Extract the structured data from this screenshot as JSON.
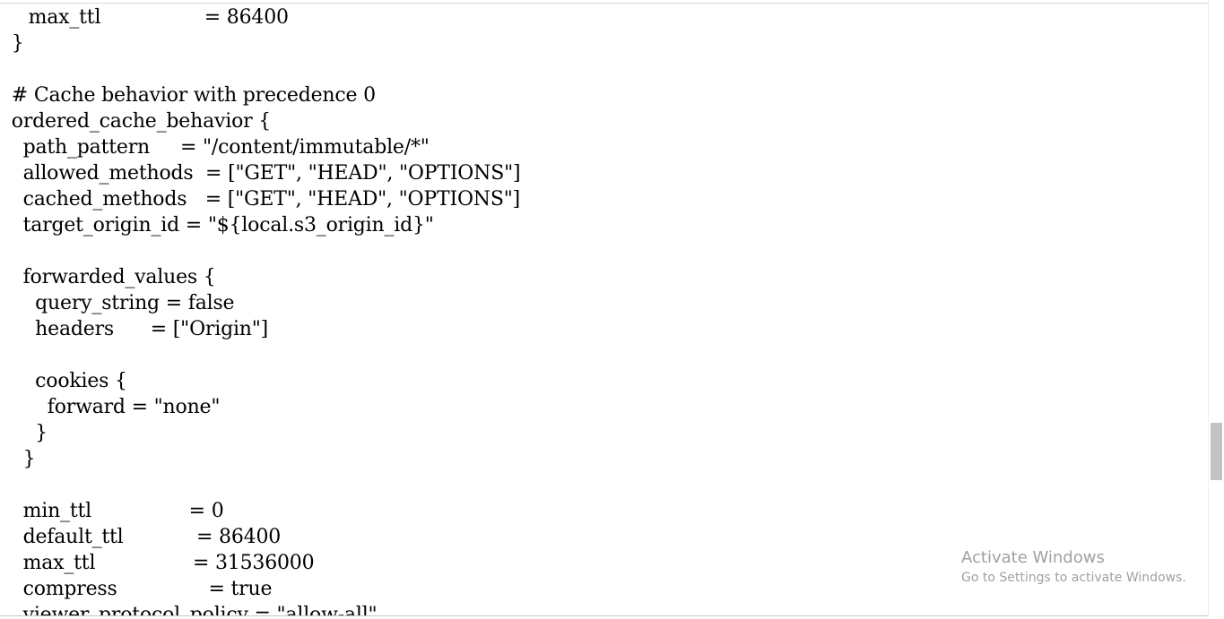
{
  "editor": {
    "lines": [
      "  max_ttl                 = 86400",
      " }",
      "",
      " # Cache behavior with precedence 0",
      " ordered_cache_behavior {",
      "  path_pattern     = \"/content/immutable/*\"",
      "  allowed_methods  = [\"GET\", \"HEAD\", \"OPTIONS\"]",
      "  cached_methods   = [\"GET\", \"HEAD\", \"OPTIONS\"]",
      "  target_origin_id = \"${local.s3_origin_id}\"",
      "",
      "  forwarded_values {",
      "    query_string = false",
      "    headers      = [\"Origin\"]",
      "",
      "    cookies {",
      "      forward = \"none\"",
      "    }",
      "  }",
      "",
      "  min_ttl                = 0",
      "  default_ttl            = 86400",
      "  max_ttl                = 31536000",
      "  compress               = true",
      "  viewer_protocol_policy = \"allow-all\""
    ]
  },
  "watermark": {
    "title": "Activate Windows",
    "subtitle": "Go to Settings to activate Windows."
  }
}
